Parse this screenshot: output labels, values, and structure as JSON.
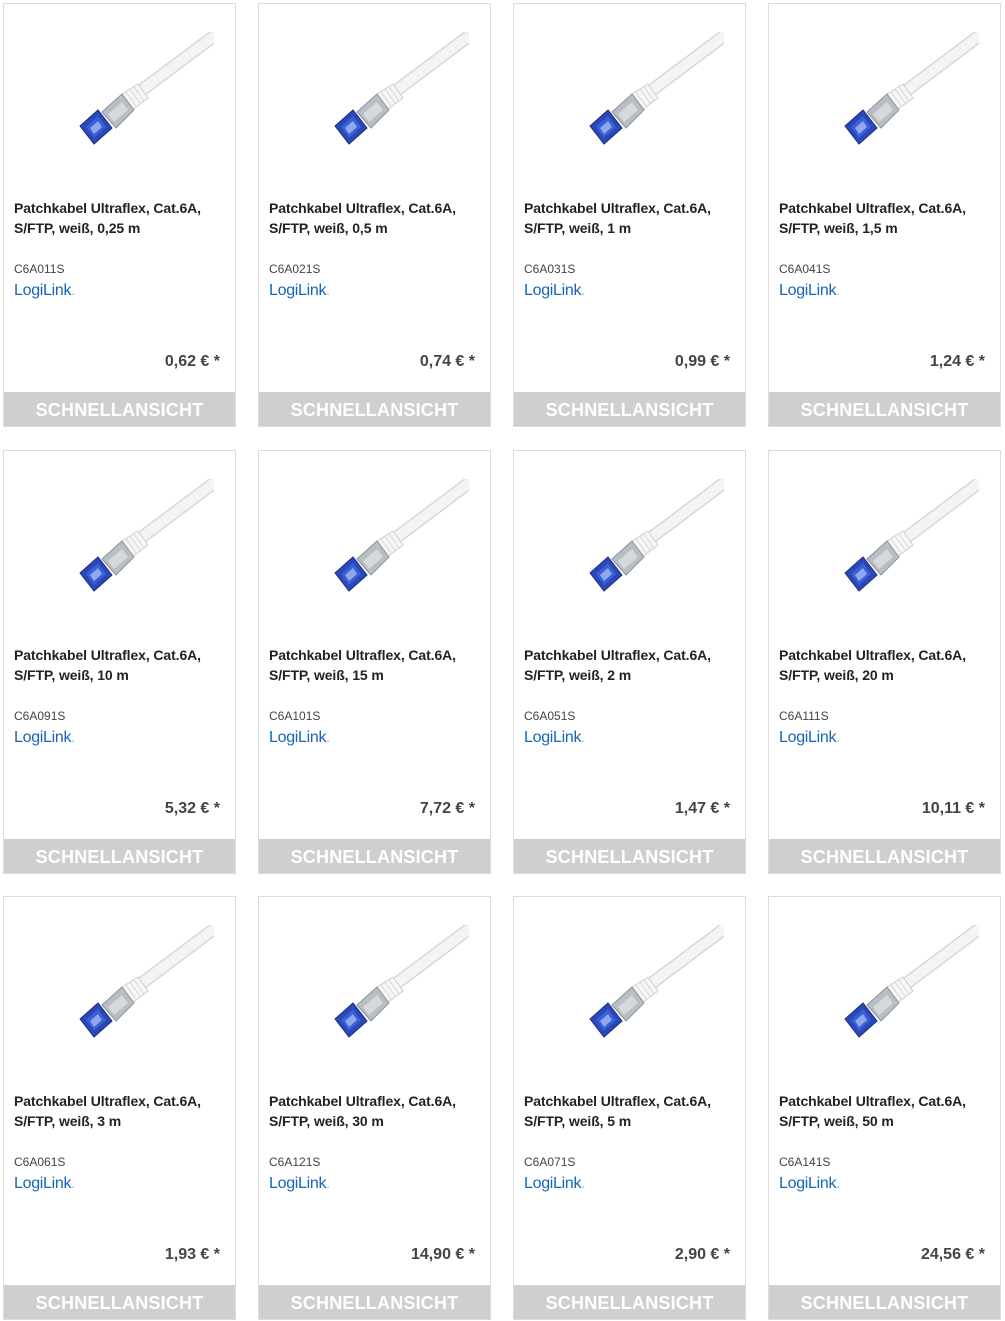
{
  "products": [
    {
      "title": "Patchkabel Ultraflex, Cat.6A, S/FTP, weiß, 0,25 m",
      "sku": "C6A011S",
      "brand": "LogiLink",
      "price": "0,62 € *",
      "button": "SCHNELLANSICHT"
    },
    {
      "title": "Patchkabel Ultraflex, Cat.6A, S/FTP, weiß, 0,5 m",
      "sku": "C6A021S",
      "brand": "LogiLink",
      "price": "0,74 € *",
      "button": "SCHNELLANSICHT"
    },
    {
      "title": "Patchkabel Ultraflex, Cat.6A, S/FTP, weiß, 1 m",
      "sku": "C6A031S",
      "brand": "LogiLink",
      "price": "0,99 € *",
      "button": "SCHNELLANSICHT"
    },
    {
      "title": "Patchkabel Ultraflex, Cat.6A, S/FTP, weiß, 1,5 m",
      "sku": "C6A041S",
      "brand": "LogiLink",
      "price": "1,24 € *",
      "button": "SCHNELLANSICHT"
    },
    {
      "title": "Patchkabel Ultraflex, Cat.6A, S/FTP, weiß, 10 m",
      "sku": "C6A091S",
      "brand": "LogiLink",
      "price": "5,32 € *",
      "button": "SCHNELLANSICHT"
    },
    {
      "title": "Patchkabel Ultraflex, Cat.6A, S/FTP, weiß, 15 m",
      "sku": "C6A101S",
      "brand": "LogiLink",
      "price": "7,72 € *",
      "button": "SCHNELLANSICHT"
    },
    {
      "title": "Patchkabel Ultraflex, Cat.6A, S/FTP, weiß, 2 m",
      "sku": "C6A051S",
      "brand": "LogiLink",
      "price": "1,47 € *",
      "button": "SCHNELLANSICHT"
    },
    {
      "title": "Patchkabel Ultraflex, Cat.6A, S/FTP, weiß, 20 m",
      "sku": "C6A111S",
      "brand": "LogiLink",
      "price": "10,11 € *",
      "button": "SCHNELLANSICHT"
    },
    {
      "title": "Patchkabel Ultraflex, Cat.6A, S/FTP, weiß, 3 m",
      "sku": "C6A061S",
      "brand": "LogiLink",
      "price": "1,93 € *",
      "button": "SCHNELLANSICHT"
    },
    {
      "title": "Patchkabel Ultraflex, Cat.6A, S/FTP, weiß, 30 m",
      "sku": "C6A121S",
      "brand": "LogiLink",
      "price": "14,90 € *",
      "button": "SCHNELLANSICHT"
    },
    {
      "title": "Patchkabel Ultraflex, Cat.6A, S/FTP, weiß, 5 m",
      "sku": "C6A071S",
      "brand": "LogiLink",
      "price": "2,90 € *",
      "button": "SCHNELLANSICHT"
    },
    {
      "title": "Patchkabel Ultraflex, Cat.6A, S/FTP, weiß, 50 m",
      "sku": "C6A141S",
      "brand": "LogiLink",
      "price": "24,56 € *",
      "button": "SCHNELLANSICHT"
    }
  ],
  "colors": {
    "brand_blue": "#1565b8",
    "button_grey": "#cfcfcf",
    "border": "#dcdcdc",
    "connector_blue": "#2a48b8",
    "cable_white": "#f2f2f2"
  },
  "icons": {
    "product_image": "patch-cable-icon"
  }
}
